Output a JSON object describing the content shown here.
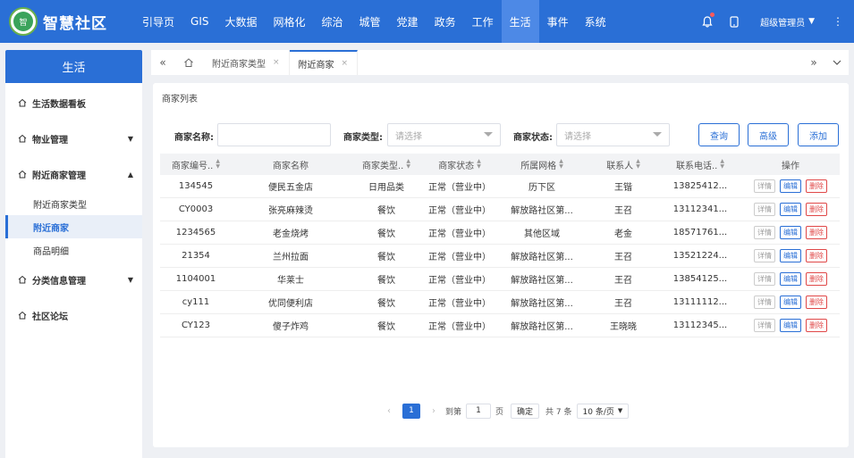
{
  "app": {
    "logo_mark": "智",
    "title": "智慧社区"
  },
  "nav": [
    {
      "label": "引导页"
    },
    {
      "label": "GIS"
    },
    {
      "label": "大数据"
    },
    {
      "label": "网格化"
    },
    {
      "label": "综治"
    },
    {
      "label": "城管"
    },
    {
      "label": "党建"
    },
    {
      "label": "政务"
    },
    {
      "label": "工作"
    },
    {
      "label": "生活",
      "active": true
    },
    {
      "label": "事件"
    },
    {
      "label": "系统"
    }
  ],
  "header": {
    "user": "超级管理员",
    "icons": [
      "bell-icon",
      "mobile-icon",
      "more-icon"
    ]
  },
  "sidebar": {
    "title": "生活",
    "groups": [
      {
        "label": "生活数据看板"
      },
      {
        "label": "物业管理",
        "arrow": "▼"
      },
      {
        "label": "附近商家管理",
        "arrow": "▲"
      },
      {
        "label": "分类信息管理",
        "arrow": "▼"
      },
      {
        "label": "社区论坛"
      }
    ],
    "subitems": [
      {
        "label": "附近商家类型"
      },
      {
        "label": "附近商家",
        "active": true
      },
      {
        "label": "商品明细"
      }
    ]
  },
  "tabs": [
    {
      "label": "附近商家类型"
    },
    {
      "label": "附近商家",
      "active": true
    }
  ],
  "panel": {
    "title": "商家列表",
    "filters": {
      "name_label": "商家名称:",
      "name_placeholder": "",
      "type_label": "商家类型:",
      "type_placeholder": "请选择",
      "status_label": "商家状态:",
      "status_placeholder": "请选择"
    },
    "buttons": {
      "query": "查询",
      "advanced": "高级",
      "add": "添加"
    }
  },
  "table": {
    "columns": [
      "商家编号..",
      "商家名称",
      "商家类型..",
      "商家状态",
      "所属网格",
      "联系人",
      "联系电话..",
      "操作"
    ],
    "ops": {
      "detail": "详情",
      "edit": "编辑",
      "delete": "删除"
    },
    "rows": [
      [
        "134545",
        "便民五金店",
        "日用品类",
        "正常（营业中）",
        "历下区",
        "王锴",
        "13825412..."
      ],
      [
        "CY0003",
        "张亮麻辣烫",
        "餐饮",
        "正常（营业中）",
        "解放路社区第...",
        "王召",
        "13112341..."
      ],
      [
        "1234565",
        "老金烧烤",
        "餐饮",
        "正常（营业中）",
        "其他区域",
        "老金",
        "18571761..."
      ],
      [
        "21354",
        "兰州拉面",
        "餐饮",
        "正常（营业中）",
        "解放路社区第...",
        "王召",
        "13521224..."
      ],
      [
        "1104001",
        "华莱士",
        "餐饮",
        "正常（营业中）",
        "解放路社区第...",
        "王召",
        "13854125..."
      ],
      [
        "cy111",
        "优同便利店",
        "餐饮",
        "正常（营业中）",
        "解放路社区第...",
        "王召",
        "13111112..."
      ],
      [
        "CY123",
        "傻子炸鸡",
        "餐饮",
        "正常（营业中）",
        "解放路社区第...",
        "王晓晓",
        "13112345..."
      ]
    ]
  },
  "pager": {
    "current": "1",
    "goto_label": "到第",
    "goto_value": "1",
    "page_unit": "页",
    "confirm": "确定",
    "total": "共 7 条",
    "page_size": "10 条/页"
  },
  "colors": {
    "primary": "#2a6fd6",
    "danger": "#e04848"
  }
}
